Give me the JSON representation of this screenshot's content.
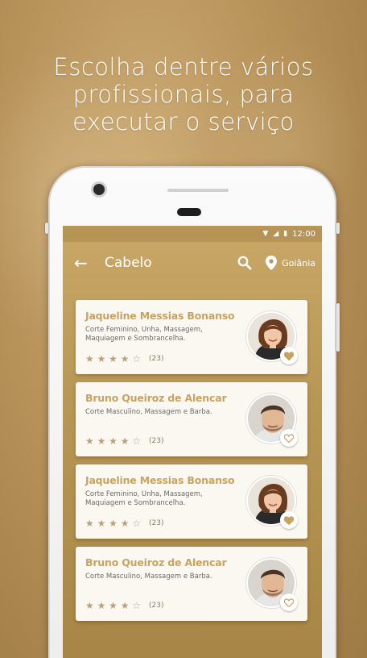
{
  "headline": [
    "Escolha dentre vários",
    "profissionais, para",
    "executar o serviço"
  ],
  "status_bar": {
    "time": "12:00"
  },
  "appbar": {
    "back_glyph": "←",
    "title": "Cabelo",
    "location": "Goiânia"
  },
  "colors": {
    "accent": "#c8a35f",
    "gold_dark": "#a78546",
    "card_bg": "#fbf8f2"
  },
  "professionals": [
    {
      "name": "Jaqueline Messias Bonanso",
      "services": "Corte Feminino, Unha, Massagem, Maquiagem e Sombrancelha.",
      "stars": 4,
      "reviews": "(23)",
      "gender": "female",
      "favorite": true
    },
    {
      "name": "Bruno Queiroz de Alencar",
      "services": "Corte Masculino, Massagem e Barba.",
      "stars": 4,
      "reviews": "(23)",
      "gender": "male",
      "favorite": false
    },
    {
      "name": "Jaqueline Messias Bonanso",
      "services": "Corte Feminino, Unha, Massagem, Maquiagem e Sombrancelha.",
      "stars": 4,
      "reviews": "(23)",
      "gender": "female",
      "favorite": true
    },
    {
      "name": "Bruno Queiroz de Alencar",
      "services": "Corte Masculino, Massagem e Barba.",
      "stars": 4,
      "reviews": "(23)",
      "gender": "male",
      "favorite": false
    }
  ]
}
